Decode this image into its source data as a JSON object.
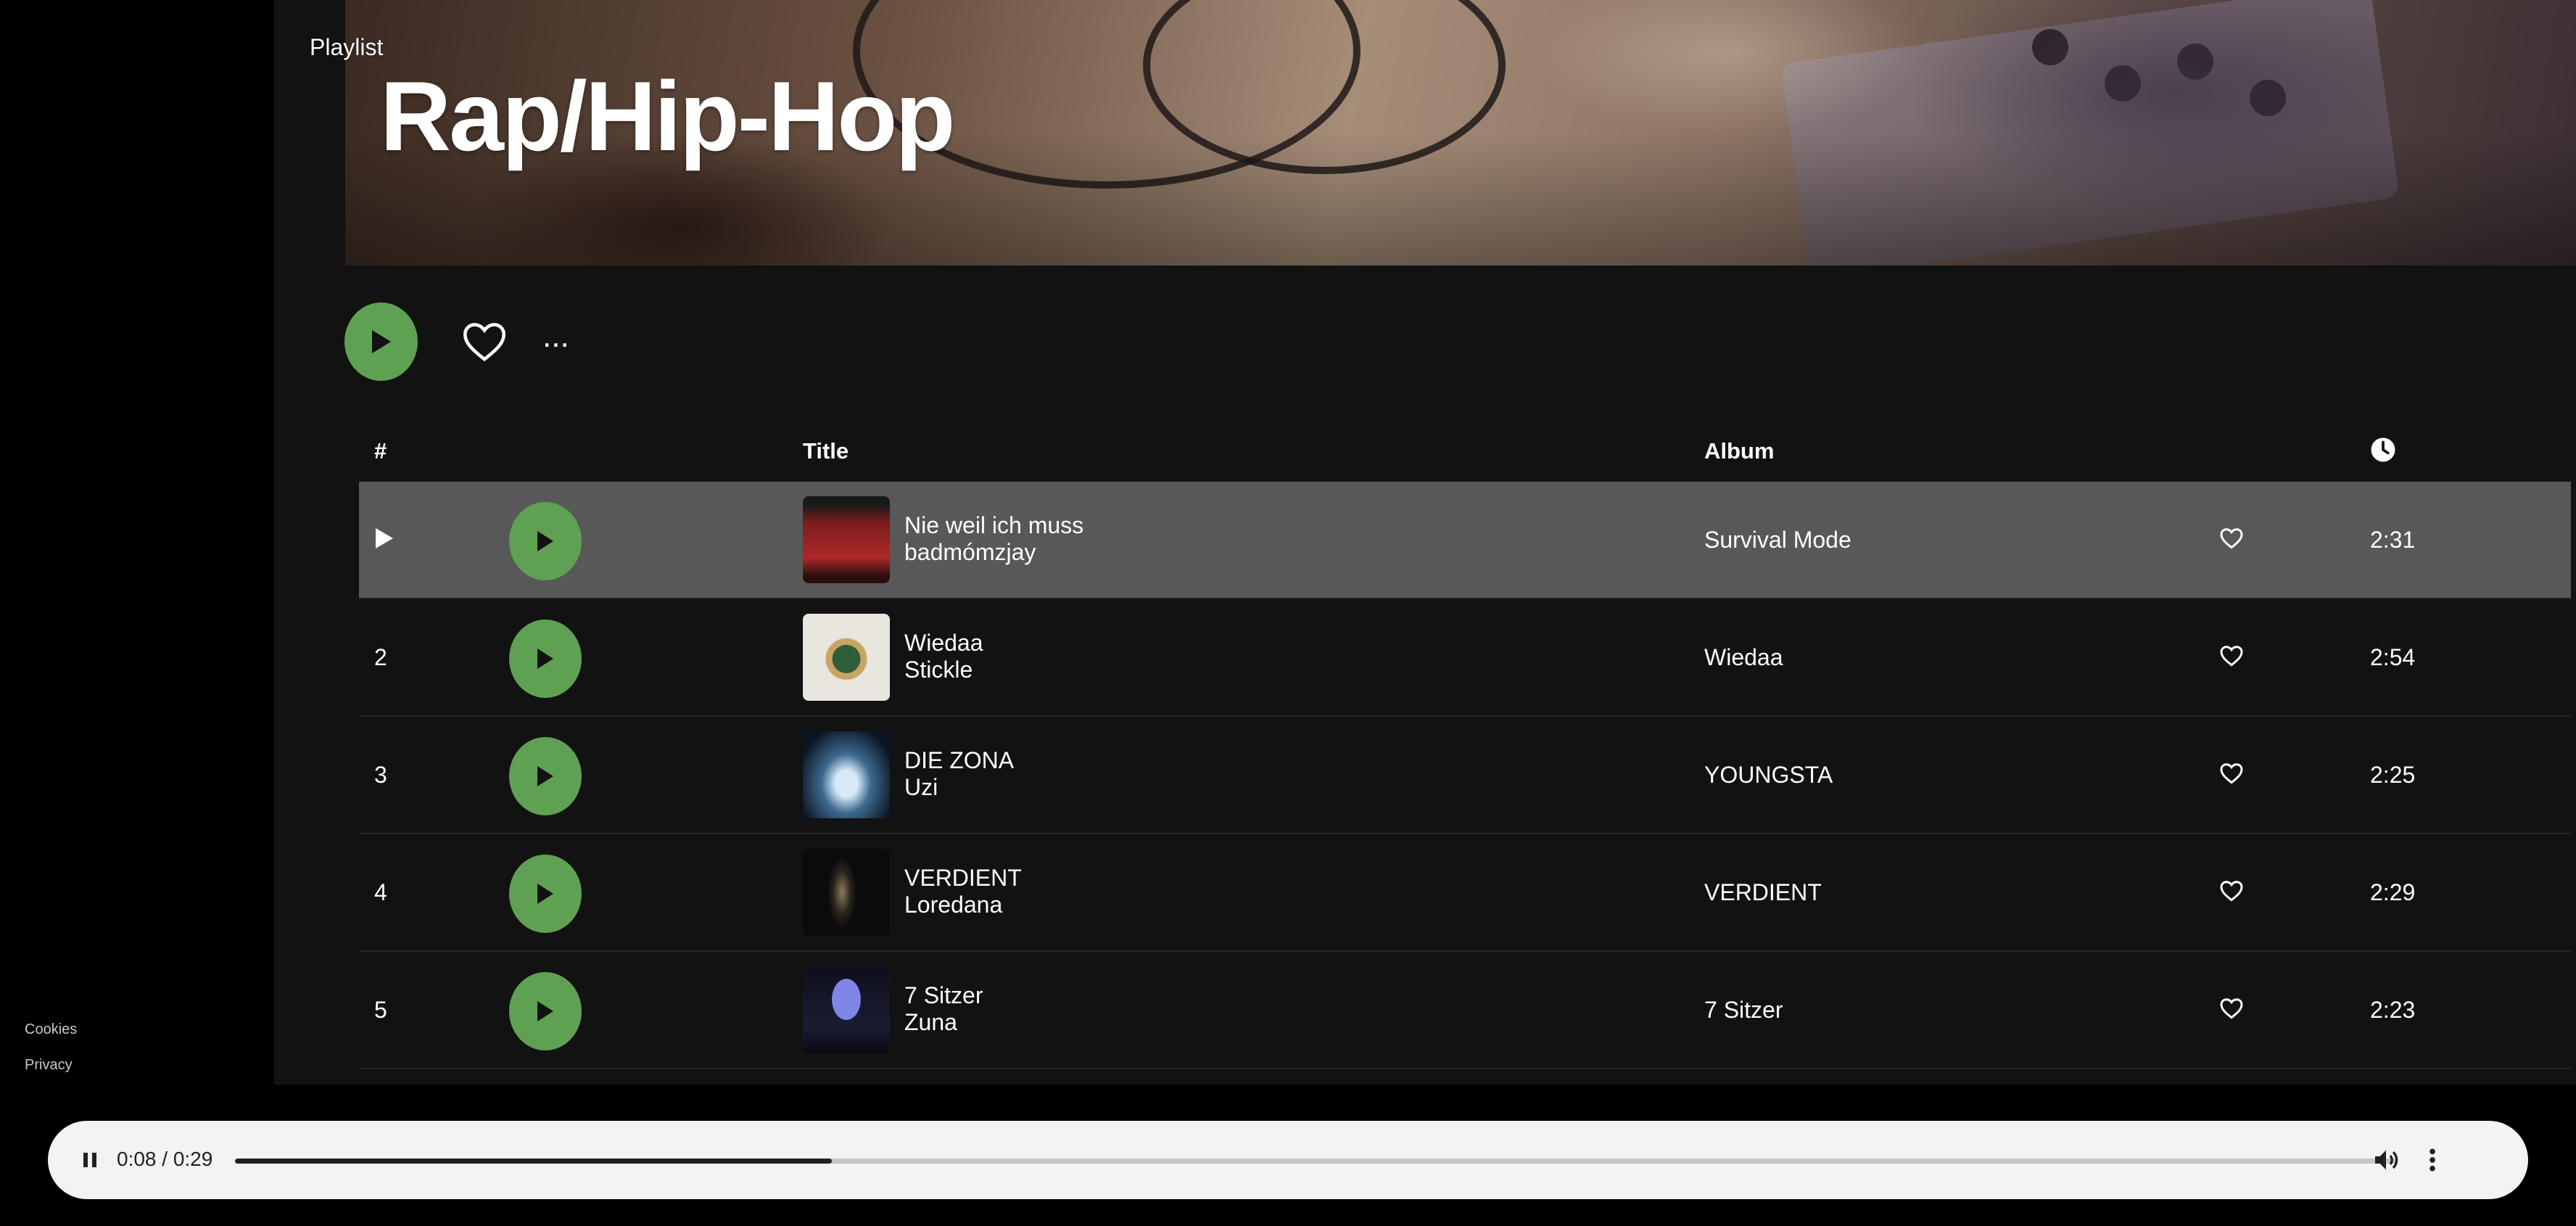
{
  "sidebar": {
    "links": [
      "Cookies",
      "Privacy"
    ]
  },
  "hero": {
    "label": "Playlist",
    "title": "Rap/Hip-Hop"
  },
  "actions": {
    "more_label": "..."
  },
  "table": {
    "headers": {
      "num": "#",
      "title": "Title",
      "album": "Album",
      "duration_icon": "clock-icon"
    },
    "rows": [
      {
        "num": "",
        "title": "Nie weil ich muss",
        "artist": "badmómzjay",
        "album": "Survival Mode",
        "duration": "2:31",
        "active": true
      },
      {
        "num": "2",
        "title": "Wiedaa",
        "artist": "Stickle",
        "album": "Wiedaa",
        "duration": "2:54",
        "active": false
      },
      {
        "num": "3",
        "title": "DIE ZONA",
        "artist": "Uzi",
        "album": "YOUNGSTA",
        "duration": "2:25",
        "active": false
      },
      {
        "num": "4",
        "title": "VERDIENT",
        "artist": "Loredana",
        "album": "VERDIENT",
        "duration": "2:29",
        "active": false
      },
      {
        "num": "5",
        "title": "7 Sitzer",
        "artist": "Zuna",
        "album": "7 Sitzer",
        "duration": "2:23",
        "active": false
      }
    ]
  },
  "player": {
    "time": "0:08 / 0:29",
    "progress": 0.276
  },
  "colors": {
    "accent_green": "#5fa152",
    "active_row": "#585858",
    "player_bg": "#f1f3f4"
  }
}
